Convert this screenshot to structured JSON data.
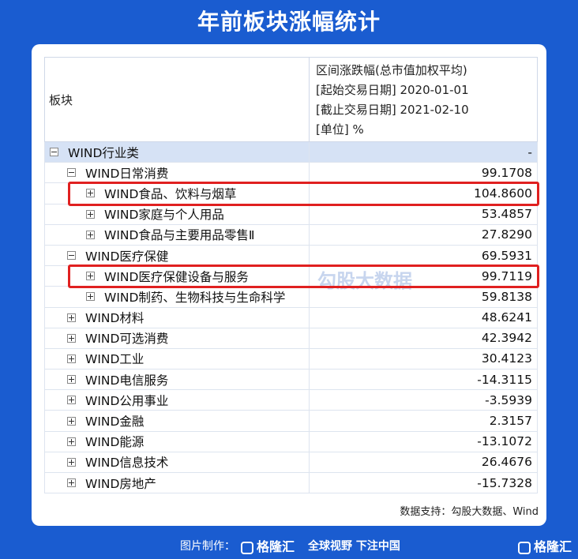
{
  "title": "年前板块涨幅统计",
  "table": {
    "header_left": "板块",
    "header_right": [
      "区间涨跌幅(总市值加权平均)",
      "[起始交易日期] 2020-01-01",
      "[截止交易日期] 2021-02-10",
      "[单位] %"
    ],
    "rows": [
      {
        "name": "WIND行业类",
        "value": "-",
        "level": 0,
        "toggle": "minus",
        "group": true
      },
      {
        "name": "WIND日常消费",
        "value": "99.1708",
        "level": 1,
        "toggle": "minus"
      },
      {
        "name": "WIND食品、饮料与烟草",
        "value": "104.8600",
        "level": 2,
        "toggle": "plus",
        "highlight": true
      },
      {
        "name": "WIND家庭与个人用品",
        "value": "53.4857",
        "level": 2,
        "toggle": "plus"
      },
      {
        "name": "WIND食品与主要用品零售Ⅱ",
        "value": "27.8290",
        "level": 2,
        "toggle": "plus"
      },
      {
        "name": "WIND医疗保健",
        "value": "69.5931",
        "level": 1,
        "toggle": "minus"
      },
      {
        "name": "WIND医疗保健设备与服务",
        "value": "99.7119",
        "level": 2,
        "toggle": "plus",
        "highlight": true
      },
      {
        "name": "WIND制药、生物科技与生命科学",
        "value": "59.8138",
        "level": 2,
        "toggle": "plus"
      },
      {
        "name": "WIND材料",
        "value": "48.6241",
        "level": 1,
        "toggle": "plus"
      },
      {
        "name": "WIND可选消费",
        "value": "42.3942",
        "level": 1,
        "toggle": "plus"
      },
      {
        "name": "WIND工业",
        "value": "30.4123",
        "level": 1,
        "toggle": "plus"
      },
      {
        "name": "WIND电信服务",
        "value": "-14.3115",
        "level": 1,
        "toggle": "plus"
      },
      {
        "name": "WIND公用事业",
        "value": "-3.5939",
        "level": 1,
        "toggle": "plus"
      },
      {
        "name": "WIND金融",
        "value": "2.3157",
        "level": 1,
        "toggle": "plus"
      },
      {
        "name": "WIND能源",
        "value": "-13.1072",
        "level": 1,
        "toggle": "plus"
      },
      {
        "name": "WIND信息技术",
        "value": "26.4676",
        "level": 1,
        "toggle": "plus"
      },
      {
        "name": "WIND房地产",
        "value": "-15.7328",
        "level": 1,
        "toggle": "plus"
      }
    ]
  },
  "watermark": "勾股大数据",
  "source": "数据支持：勾股大数据、Wind",
  "footer": {
    "made_by": "图片制作：",
    "logo": "格隆汇",
    "slogan": "全球视野 下注中国",
    "logo_right": "格隆汇"
  },
  "colors": {
    "background": "#1a5cd0",
    "group_row": "#d6e2f5",
    "highlight": "#e02020"
  }
}
